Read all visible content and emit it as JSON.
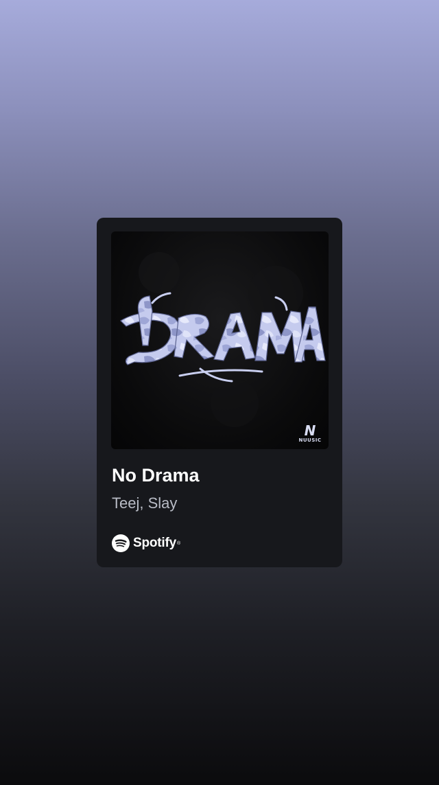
{
  "track": {
    "title": "No Drama",
    "artists": "Teej, Slay"
  },
  "cover": {
    "artwork_text": "DRAMA",
    "label_mark": "N",
    "label_name": "NUUSIC"
  },
  "branding": {
    "service_name": "Spotify",
    "trademark": "®",
    "icon": "spotify-logo-icon"
  },
  "colors": {
    "card_background": "#17181c",
    "gradient_top": "#a6abdb",
    "gradient_bottom": "#0b0b0d",
    "artwork_accent": "#c9cff0",
    "title_text": "#ffffff",
    "artist_text": "#b9bcc6"
  }
}
